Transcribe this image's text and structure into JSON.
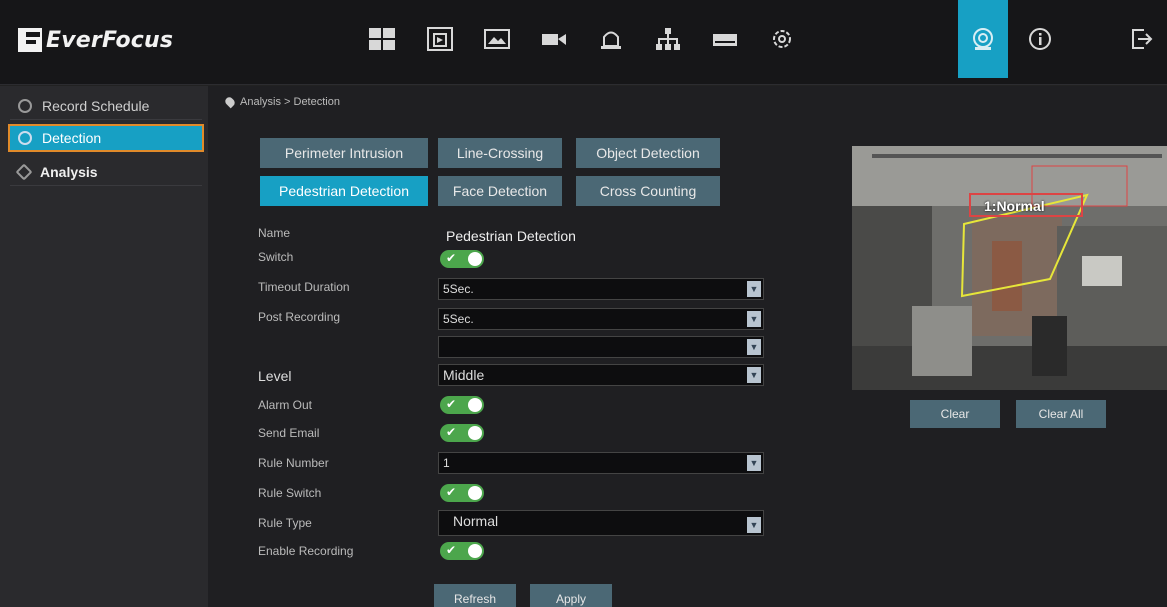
{
  "brand": {
    "name": "EverFocus"
  },
  "nav": {
    "icons": [
      {
        "name": "grid-layout-icon",
        "active": false
      },
      {
        "name": "playback-icon",
        "active": false
      },
      {
        "name": "image-settings-icon",
        "active": false
      },
      {
        "name": "camera-icon",
        "active": false
      },
      {
        "name": "alarm-bell-icon",
        "active": false
      },
      {
        "name": "network-icon",
        "active": false
      },
      {
        "name": "storage-icon",
        "active": false
      },
      {
        "name": "gear-icon",
        "active": false
      },
      {
        "name": "smart-analysis-icon",
        "active": true
      },
      {
        "name": "info-icon",
        "active": false
      },
      {
        "name": "logout-icon",
        "active": false
      }
    ]
  },
  "sidebar": {
    "items": [
      {
        "label": "Record Schedule",
        "active": false
      },
      {
        "label": "Detection",
        "active": true
      },
      {
        "label": "Analysis",
        "active": false
      }
    ]
  },
  "breadcrumb": {
    "text": "Analysis > Detection"
  },
  "tabs": [
    {
      "label": "Perimeter Intrusion",
      "active": false
    },
    {
      "label": "Line-Crossing",
      "active": false
    },
    {
      "label": "Object Detection",
      "active": false
    },
    {
      "label": "Pedestrian Detection",
      "active": true
    },
    {
      "label": "Face Detection",
      "active": false
    },
    {
      "label": "Cross Counting",
      "active": false
    }
  ],
  "form": {
    "name_label": "Name",
    "name_value": "Pedestrian Detection",
    "switch_label": "Switch",
    "timeout_label": "Timeout Duration",
    "timeout_value": "5Sec.",
    "post_recording_label": "Post Recording",
    "post_recording_value": "5Sec.",
    "extra_value": "",
    "level_label": "Level",
    "level_value": "Middle",
    "alarm_out_label": "Alarm Out",
    "send_email_label": "Send Email",
    "rule_number_label": "Rule Number",
    "rule_number_value": "1",
    "rule_switch_label": "Rule Switch",
    "rule_type_label": "Rule Type",
    "rule_type_value": "Normal",
    "enable_recording_label": "Enable Recording",
    "refresh_label": "Refresh",
    "apply_label": "Apply"
  },
  "preview": {
    "overlay_label": "1:Normal",
    "clear_label": "Clear",
    "clear_all_label": "Clear All"
  },
  "colors": {
    "accent": "#17a0c4",
    "tab": "#4b6875",
    "toggle_on": "#4ca64c",
    "active_border": "#e08a2a"
  }
}
